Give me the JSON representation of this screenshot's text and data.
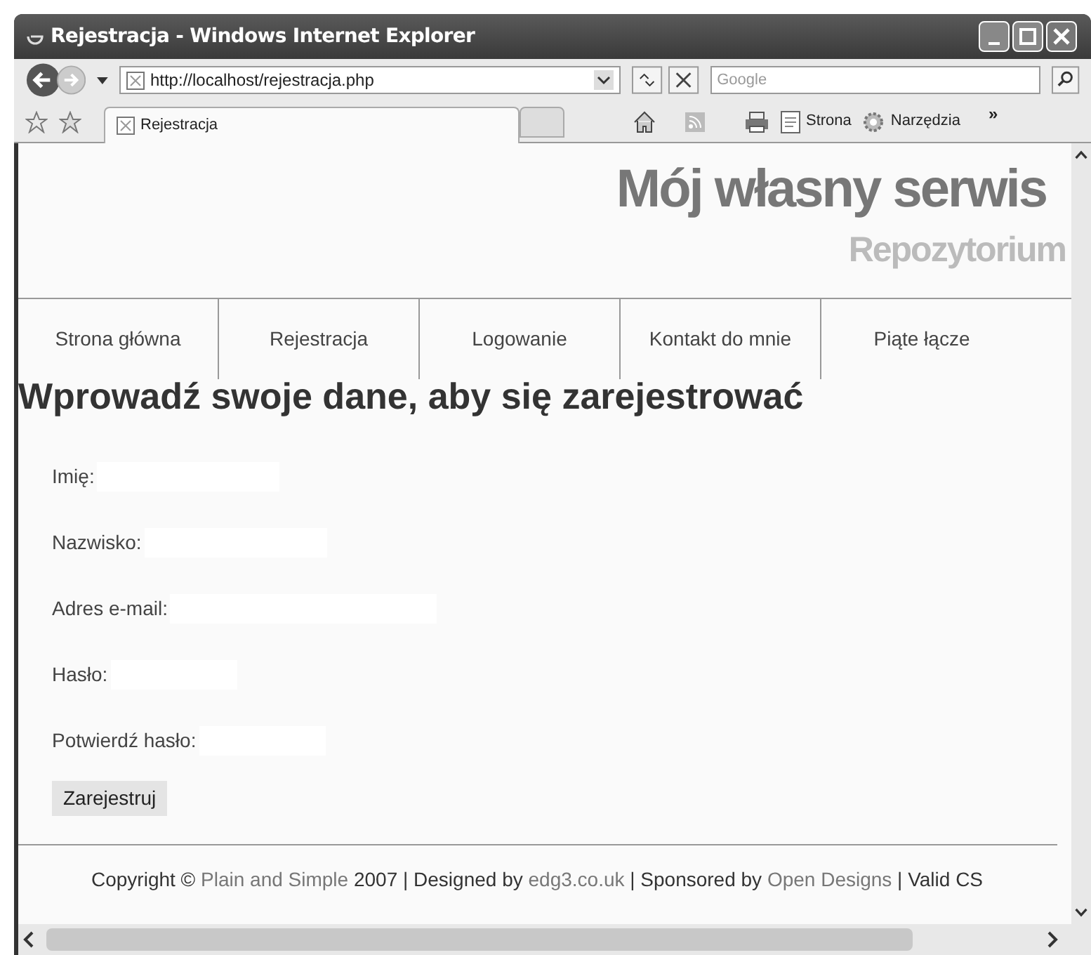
{
  "window": {
    "title": "Rejestracja - Windows Internet Explorer"
  },
  "address_bar": {
    "url": "http://localhost/rejestracja.php"
  },
  "search": {
    "placeholder": "Google"
  },
  "tab": {
    "label": "Rejestracja"
  },
  "toolbar": [
    {
      "label": "Strona"
    },
    {
      "label": "Narzędzia"
    }
  ],
  "toolbar_overflow": "»",
  "site": {
    "title": "Mój własny serwis",
    "subtitle": "Repozytorium"
  },
  "nav": [
    {
      "label": "Strona główna"
    },
    {
      "label": "Rejestracja"
    },
    {
      "label": "Logowanie"
    },
    {
      "label": "Kontakt do mnie"
    },
    {
      "label": "Piąte łącze"
    }
  ],
  "heading": "Wprowadź swoje dane, aby się zarejestrować",
  "form": {
    "fields": [
      {
        "label": "Imię:"
      },
      {
        "label": "Nazwisko:"
      },
      {
        "label": "Adres e-mail:"
      },
      {
        "label": "Hasło:"
      },
      {
        "label": "Potwierdź hasło:"
      }
    ],
    "submit": "Zarejestruj"
  },
  "footer": [
    {
      "kind": "text",
      "text": "Copyright © "
    },
    {
      "kind": "link",
      "text": "Plain and Simple"
    },
    {
      "kind": "text",
      "text": " 2007 | Designed by "
    },
    {
      "kind": "link",
      "text": "edg3.co.uk"
    },
    {
      "kind": "text",
      "text": " | Sponsored by "
    },
    {
      "kind": "link",
      "text": "Open Designs"
    },
    {
      "kind": "text",
      "text": " | Valid CS"
    }
  ]
}
